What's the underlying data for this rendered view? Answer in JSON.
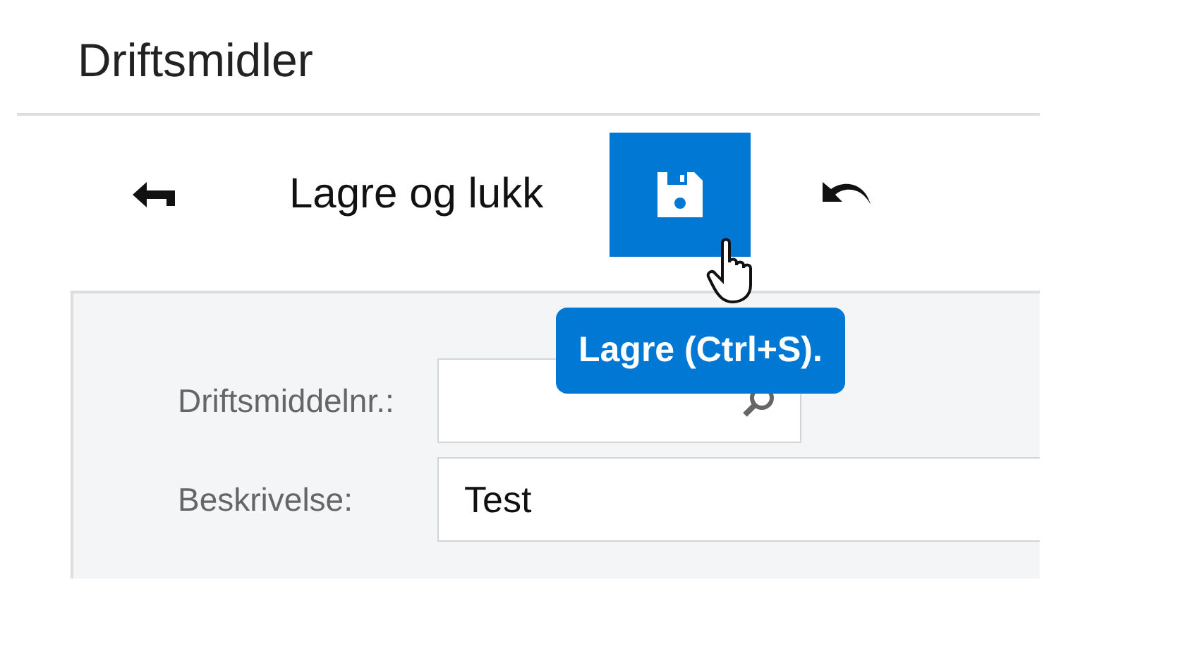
{
  "page": {
    "title": "Driftsmidler"
  },
  "toolbar": {
    "save_close_label": "Lagre og lukk"
  },
  "tooltip": {
    "text": "Lagre (Ctrl+S)."
  },
  "form": {
    "fields": [
      {
        "label": "Driftsmiddelnr.:",
        "kind": "lookup"
      },
      {
        "label": "Beskrivelse:",
        "kind": "text",
        "value": "Test"
      }
    ]
  }
}
